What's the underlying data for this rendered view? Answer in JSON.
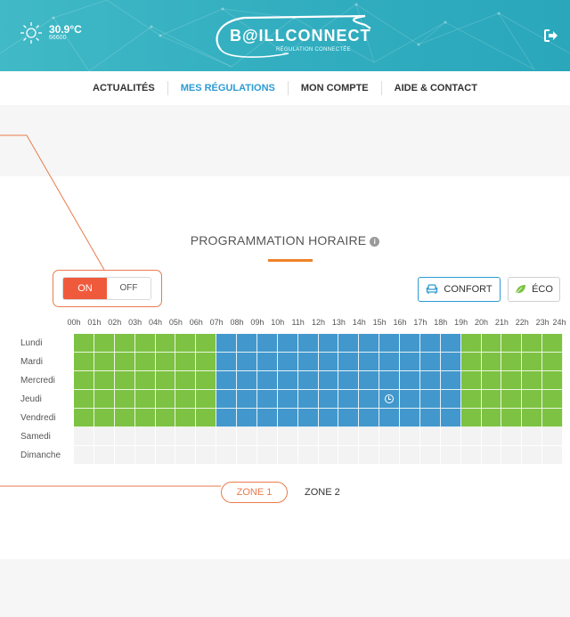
{
  "header": {
    "weather": {
      "temperature": "30.9°C",
      "postal_code": "66600",
      "icon": "sun-icon"
    },
    "logo": {
      "title": "B@ILLCONNECT",
      "subtitle": "RÉGULATION CONNECTÉE"
    },
    "logout_icon": "logout-icon",
    "accent": "#35b1c2"
  },
  "nav": {
    "items": [
      {
        "label": "ACTUALITÉS"
      },
      {
        "label": "MES RÉGULATIONS"
      },
      {
        "label": "MON COMPTE"
      },
      {
        "label": "AIDE & CONTACT"
      }
    ],
    "active_index": 1,
    "active_color": "#2d9bd3"
  },
  "schedule": {
    "title": "PROGRAMMATION HORAIRE",
    "toggle": {
      "on_label": "ON",
      "off_label": "OFF",
      "state": "ON",
      "on_color": "#f05a3c"
    },
    "modes": {
      "confort": {
        "label": "CONFORT",
        "icon": "sofa-icon",
        "color": "#4298cc",
        "selected": true
      },
      "eco": {
        "label": "ÉCO",
        "icon": "leaf-icon",
        "color": "#7dc242",
        "selected": false
      }
    },
    "hours": [
      "00h",
      "01h",
      "02h",
      "03h",
      "04h",
      "05h",
      "06h",
      "07h",
      "08h",
      "09h",
      "10h",
      "11h",
      "12h",
      "13h",
      "14h",
      "15h",
      "16h",
      "17h",
      "18h",
      "19h",
      "20h",
      "21h",
      "22h",
      "23h",
      "24h"
    ],
    "days": [
      "Lundi",
      "Mardi",
      "Mercredi",
      "Jeudi",
      "Vendredi",
      "Samedi",
      "Dimanche"
    ],
    "grid": [
      "gggggggbbbbbbbbbbbbggggg",
      "gggggggbbbbbbbbbbbbggggg",
      "gggggggbbbbbbbbbbbbggggg",
      "gggggggbbbbbbbbbbbbggggg",
      "gggggggbbbbbbbbbbbbggggg",
      "eeeeeeeeeeeeeeeeeeeeeeee",
      "eeeeeeeeeeeeeeeeeeeeeeee"
    ],
    "clock_marker": {
      "day": "Jeudi",
      "hour": "15h",
      "icon": "clock-icon"
    }
  },
  "zones": {
    "tabs": [
      {
        "label": "ZONE 1"
      },
      {
        "label": "ZONE 2"
      }
    ],
    "active_index": 0
  }
}
